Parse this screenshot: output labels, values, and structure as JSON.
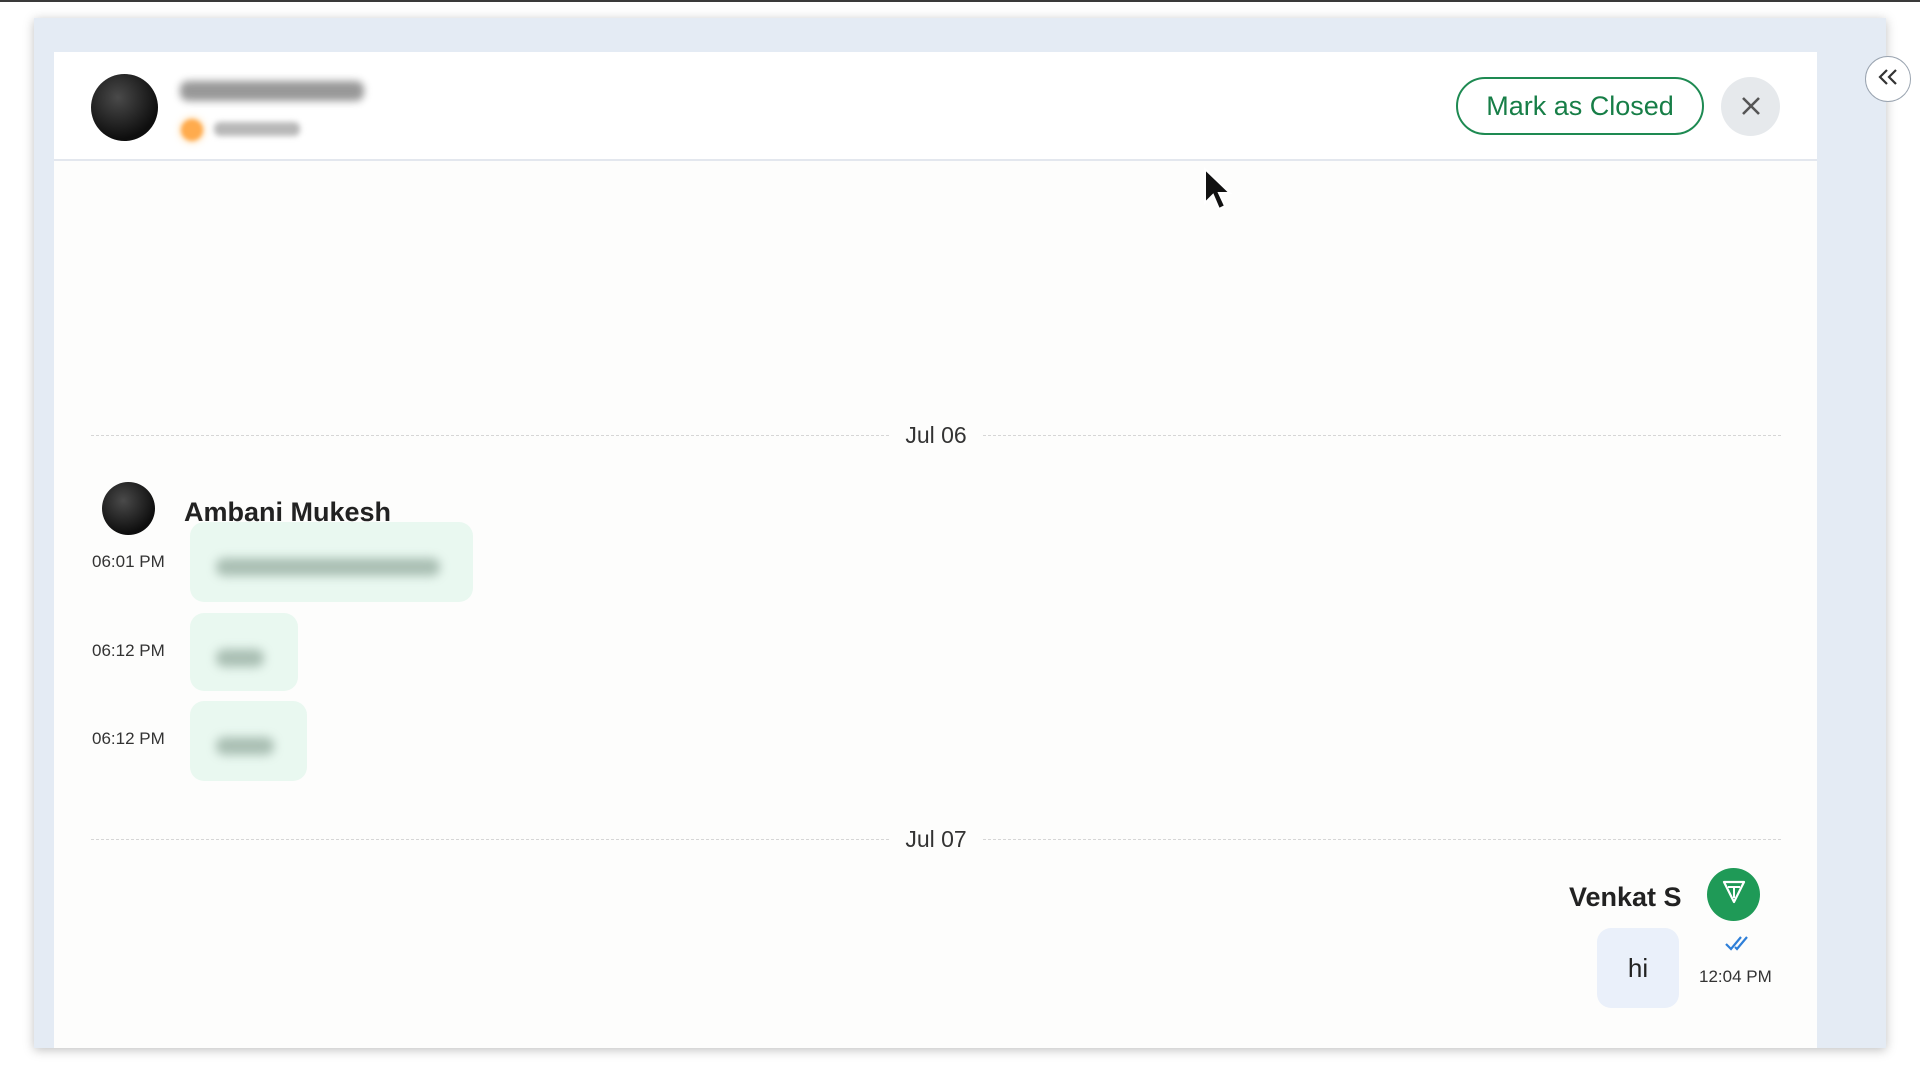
{
  "header": {
    "contact_name_redacted": "",
    "contact_status_redacted": "",
    "mark_closed_label": "Mark as Closed",
    "close_glyph": "✕",
    "collapse_glyph": "«"
  },
  "conversation": {
    "day1": {
      "date": "Jul 06",
      "sender": "Ambani Mukesh",
      "messages": [
        {
          "time": "06:01 PM",
          "text": ""
        },
        {
          "time": "06:12 PM",
          "text": ""
        },
        {
          "time": "06:12 PM",
          "text": ""
        }
      ]
    },
    "day2": {
      "date": "Jul 07",
      "sender": "Venkat S",
      "message": {
        "text": "hi",
        "time": "12:04 PM",
        "status_icon": "double-check-icon"
      }
    }
  },
  "colors": {
    "accent_green": "#1e8a52",
    "incoming_bubble": "#e9f8f0",
    "outgoing_bubble": "#eaf0fa",
    "read_tick": "#2e7fd8"
  }
}
